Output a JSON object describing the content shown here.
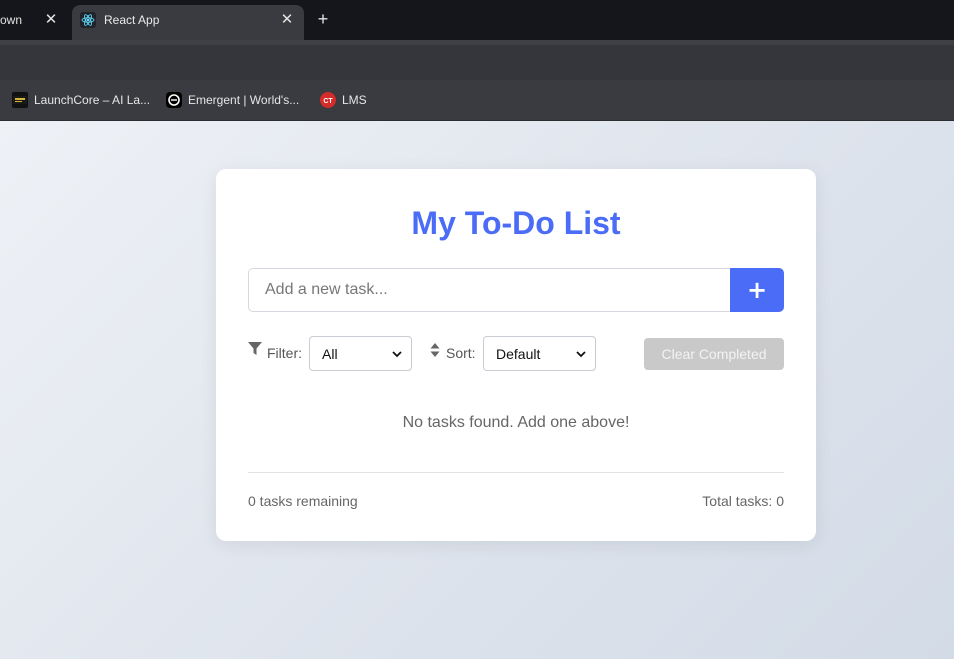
{
  "browser": {
    "prev_tab": {
      "title": "own"
    },
    "active_tab": {
      "title": "React App",
      "favicon": "react-icon"
    },
    "bookmarks": [
      {
        "label": "LaunchCore – AI La...",
        "icon": "launchcore-icon"
      },
      {
        "label": "Emergent | World's...",
        "icon": "emergent-icon"
      },
      {
        "label": "LMS",
        "icon": "lms-icon"
      }
    ]
  },
  "app": {
    "title": "My To-Do List",
    "accent_color": "#4a6cf7",
    "new_task": {
      "placeholder": "Add a new task...",
      "value": "",
      "add_button": "+"
    },
    "filter": {
      "label": "Filter:",
      "selected": "All",
      "icon": "filter-icon"
    },
    "sort": {
      "label": "Sort:",
      "selected": "Default",
      "icon": "sort-icon"
    },
    "clear_completed": "Clear Completed",
    "empty_message": "No tasks found. Add one above!",
    "footer": {
      "remaining": "0 tasks remaining",
      "total": "Total tasks: 0"
    }
  }
}
